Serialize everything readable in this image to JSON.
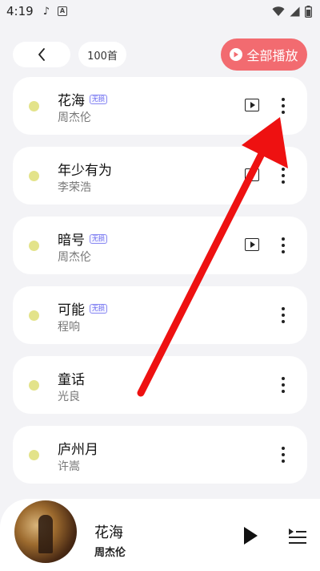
{
  "status_bar": {
    "time": "4:19",
    "icons": [
      "tiktok-icon",
      "a-badge-icon",
      "wifi-icon",
      "signal-icon",
      "battery-icon"
    ]
  },
  "header": {
    "back_icon": "chevron-left-icon",
    "song_count": "100首",
    "play_all_label": "全部播放",
    "accent_color": "#f26b70"
  },
  "songs": [
    {
      "title": "花海",
      "artist": "周杰伦",
      "lossless": "无损",
      "has_mv": true
    },
    {
      "title": "年少有为",
      "artist": "李荣浩",
      "lossless": "",
      "has_mv": true
    },
    {
      "title": "暗号",
      "artist": "周杰伦",
      "lossless": "无损",
      "has_mv": true
    },
    {
      "title": "可能",
      "artist": "程响",
      "lossless": "无损",
      "has_mv": false
    },
    {
      "title": "童话",
      "artist": "光良",
      "lossless": "",
      "has_mv": false
    },
    {
      "title": "庐州月",
      "artist": "许嵩",
      "lossless": "",
      "has_mv": false
    }
  ],
  "now_playing": {
    "title": "花海",
    "artist": "周杰伦"
  },
  "annotation": {
    "color": "#ee1111"
  }
}
